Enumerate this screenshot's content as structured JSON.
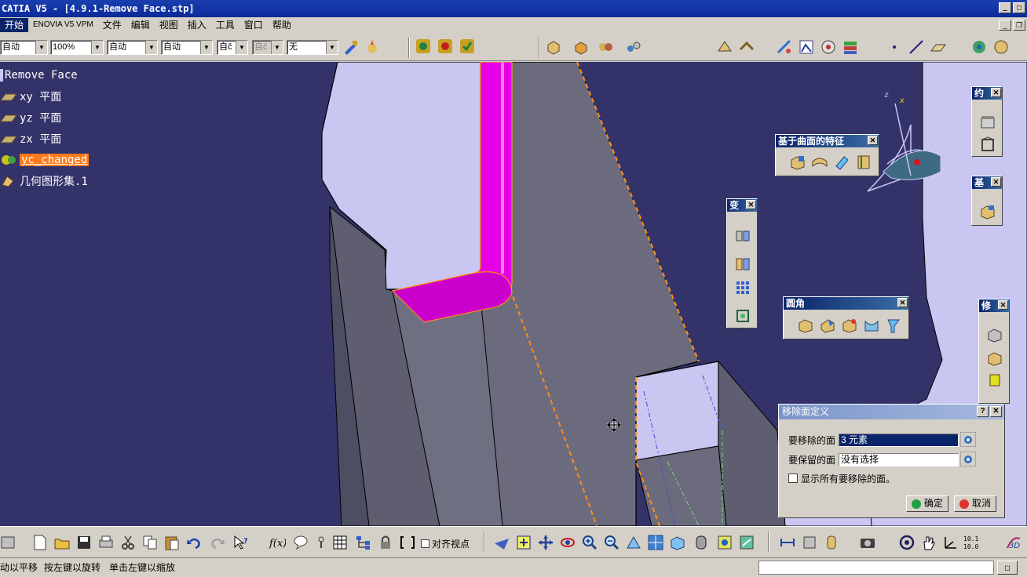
{
  "app": {
    "title": "CATIA V5 - [4.9.1-Remove Face.stp]"
  },
  "menu": {
    "items": [
      "开始",
      "ENOVIA V5 VPM",
      "文件",
      "编辑",
      "视图",
      "插入",
      "工具",
      "窗口",
      "帮助"
    ]
  },
  "top_toolbar": {
    "combo1": "自动",
    "combo2": "100%",
    "combo3": "自动",
    "combo4": "自动",
    "combo5": "自č",
    "combo6": "自č",
    "combo7": "无"
  },
  "tree": {
    "items": [
      {
        "label": "Remove Face",
        "icon": "part-body-icon"
      },
      {
        "label": "xy 平面",
        "icon": "plane-icon"
      },
      {
        "label": "yz 平面",
        "icon": "plane-icon"
      },
      {
        "label": "zx 平面",
        "icon": "plane-icon"
      },
      {
        "label": "yc_changed",
        "icon": "part-icon",
        "selected": true
      },
      {
        "label": "几何图形集.1",
        "icon": "geometrical-set-icon"
      }
    ]
  },
  "panels": {
    "surface_features": {
      "title": "基于曲面的特征"
    },
    "transform": {
      "title": "变"
    },
    "fillets": {
      "title": "圆角"
    },
    "constraints": {
      "title": "约"
    },
    "based": {
      "title": "基"
    },
    "modify": {
      "title": "修"
    }
  },
  "dialog": {
    "title": "移除面定义",
    "help": "?",
    "close": "✕",
    "faces_to_remove_label": "要移除的面",
    "faces_to_remove_value": "3 元素",
    "faces_to_keep_label": "要保留的面",
    "faces_to_keep_value": "没有选择",
    "show_all_label": "显示所有要移除的面。",
    "ok_label": "确定",
    "cancel_label": "取消"
  },
  "bottom_toolbar": {
    "align_view_label": "对齐视点"
  },
  "status": {
    "text1": "动以平移",
    "text2": "按左键以旋转",
    "text3": "单击左键以缩放"
  },
  "colors": {
    "viewport_bg": "#33336a",
    "part_gray": "#6b6b7d",
    "part_light": "#c9c6f2",
    "highlight_magenta": "#e600e6",
    "selection_orange": "#ff7a1a"
  }
}
